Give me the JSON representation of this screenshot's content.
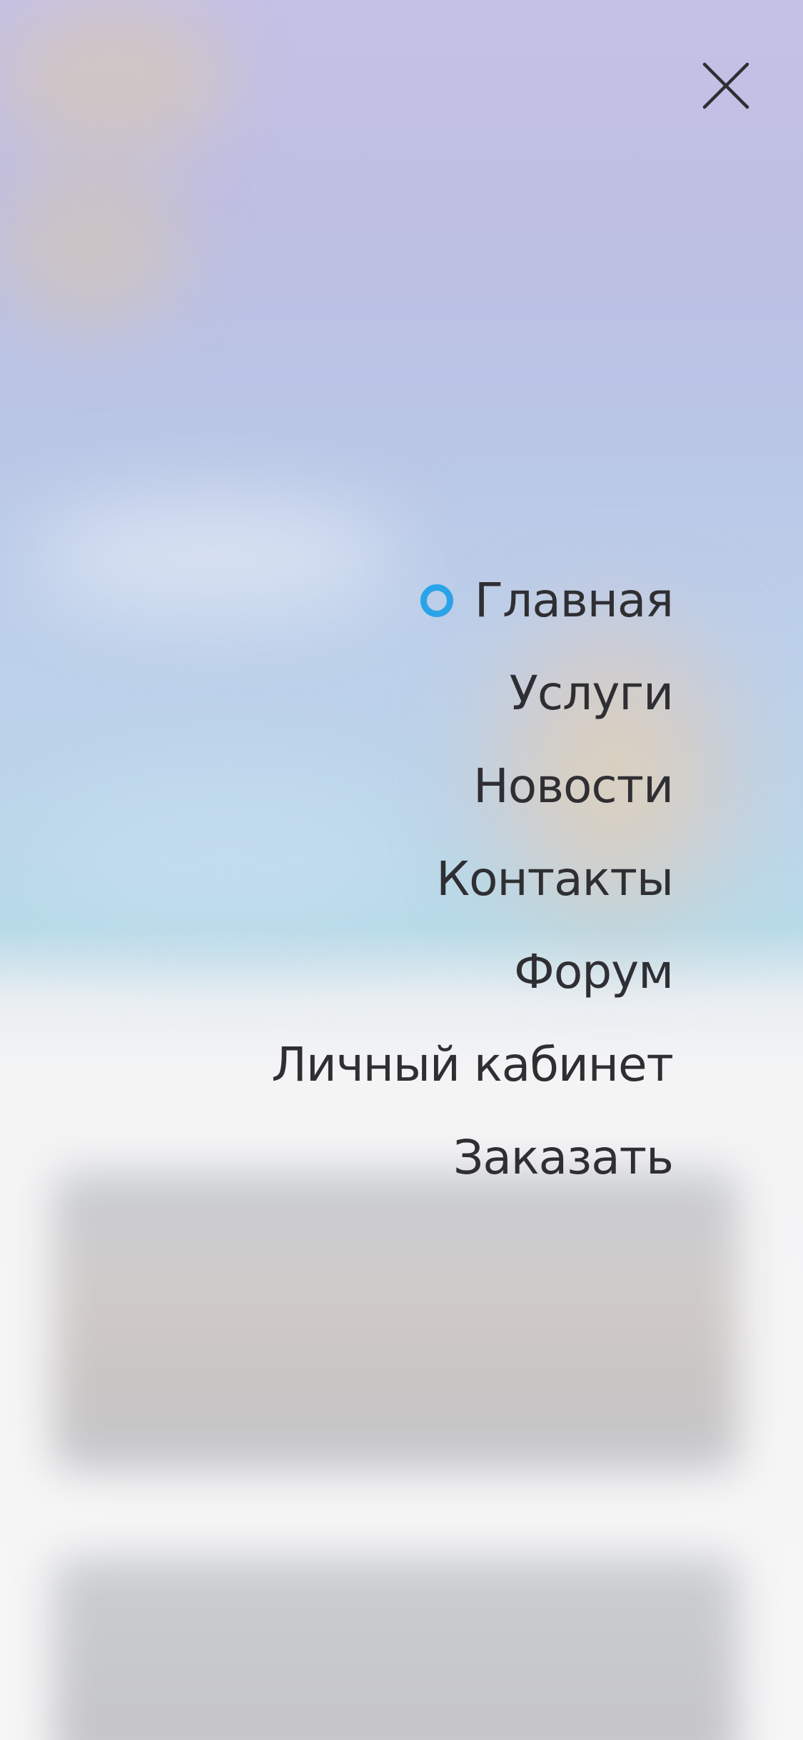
{
  "theme": {
    "text_color": "#2f2f33",
    "accent_color": "#2aa3e8",
    "close_icon_color": "#2f2f33"
  },
  "close": {
    "icon": "close-icon"
  },
  "menu": {
    "active_index": 0,
    "items": [
      {
        "label": "Главная",
        "active": true
      },
      {
        "label": "Услуги",
        "active": false
      },
      {
        "label": "Новости",
        "active": false
      },
      {
        "label": "Контакты",
        "active": false
      },
      {
        "label": "Форум",
        "active": false
      },
      {
        "label": "Личный кабинет",
        "active": false
      },
      {
        "label": "Заказать",
        "active": false
      }
    ]
  }
}
